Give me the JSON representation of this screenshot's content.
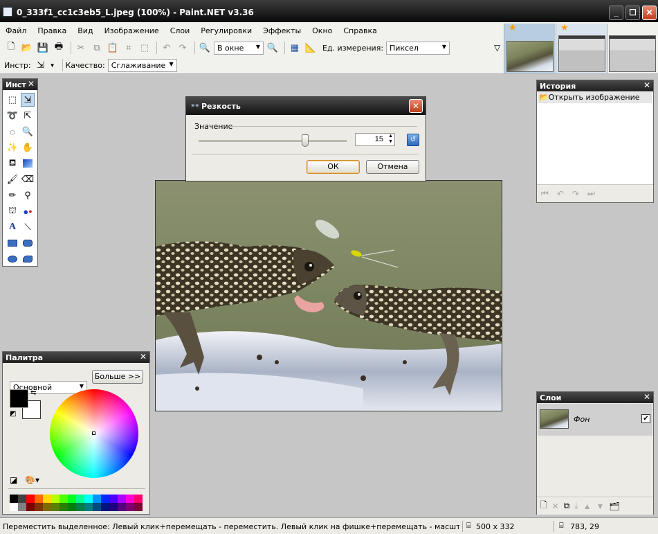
{
  "window": {
    "title": "0_333f1_cc1c3eb5_L.jpeg (100%) - Paint.NET v3.36"
  },
  "menu": [
    "Файл",
    "Правка",
    "Вид",
    "Изображение",
    "Слои",
    "Регулировки",
    "Эффекты",
    "Окно",
    "Справка"
  ],
  "toolbar": {
    "zoom_value": "В окне",
    "units_label": "Ед. измерения:",
    "units_value": "Пиксел",
    "tool_label": "Инстр:",
    "quality_label": "Качество:",
    "quality_value": "Сглаживание"
  },
  "tools_panel": {
    "title": "Инст"
  },
  "history_panel": {
    "title": "История",
    "items": [
      "Открыть изображение"
    ]
  },
  "palette_panel": {
    "title": "Палитра",
    "mode": "Основной",
    "more_button": "Больше >>"
  },
  "layers_panel": {
    "title": "Слои",
    "layers": [
      {
        "name": "Фон",
        "visible": true
      }
    ]
  },
  "dialog": {
    "title": "Резкость",
    "value_label": "Значение",
    "value": "15",
    "ok": "ОК",
    "cancel": "Отмена",
    "slider_fraction": 0.72
  },
  "status": {
    "hint": "Переместить выделенное: Левый клик+перемещать - переместить. Левый клик на фишке+перемещать - масштаб. Правый клик",
    "size": "500 x 332",
    "cursor": "783, 29"
  },
  "colors": {
    "primary": "#000000",
    "secondary": "#ffffff",
    "accent": "#f5a000"
  },
  "palette_colors": [
    "#000000",
    "#404040",
    "#ff0000",
    "#ff6a00",
    "#ffd800",
    "#b6ff00",
    "#4cff00",
    "#00ff21",
    "#00ff90",
    "#00ffff",
    "#0094ff",
    "#0026ff",
    "#4800ff",
    "#b200ff",
    "#ff00dc",
    "#ff006e"
  ],
  "palette_colors2": [
    "#ffffff",
    "#808080",
    "#7f0000",
    "#7f3300",
    "#7f6a00",
    "#5b7f00",
    "#267f00",
    "#007f0e",
    "#007f46",
    "#007f7f",
    "#004a7f",
    "#00137f",
    "#21007f",
    "#57007f",
    "#7f006e",
    "#7f0037"
  ]
}
